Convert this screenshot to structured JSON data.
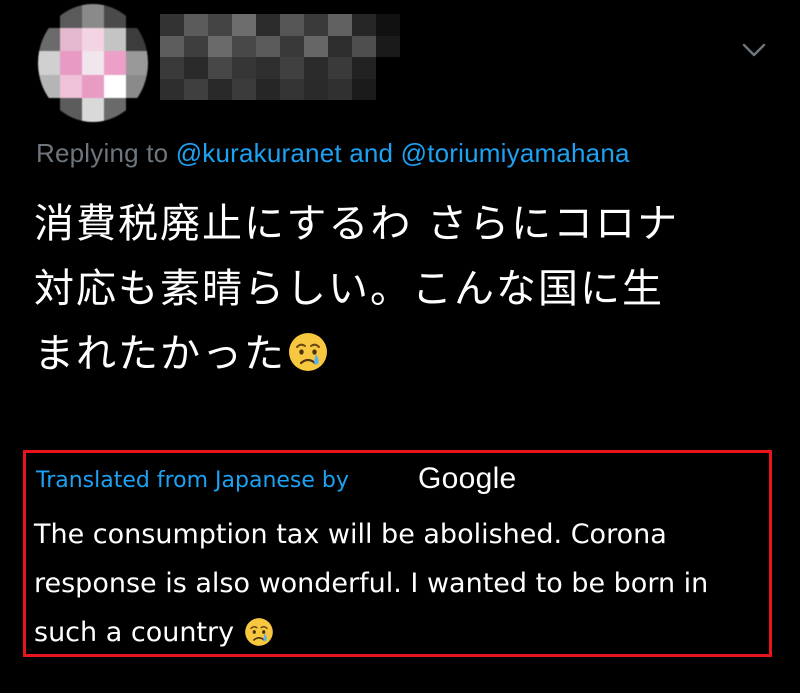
{
  "tweet": {
    "author_name": "",
    "author_handle": "",
    "reply": {
      "prefix": "Replying to ",
      "mention_1": "@kurakuranet",
      "conjunction": " and ",
      "mention_2": "@toriumiyamahana"
    },
    "text_lines": [
      "消費税廃止にするわ さらにコロナ",
      "対応も素晴らしい。こんな国に生",
      "まれたかった"
    ],
    "emoji": "crying-face"
  },
  "translation": {
    "label": "Translated from Japanese by",
    "provider": "Google",
    "text_lines": [
      "The consumption tax will be abolished. Corona",
      "response is also wonderful. I wanted to be born in",
      "such a country"
    ],
    "highlight_color": "#e8141b"
  },
  "colors": {
    "background": "#000000",
    "text": "#ffffff",
    "muted": "#6e767d",
    "link": "#1da1f2"
  },
  "icons": {
    "menu": "chevron-down-icon",
    "emoji": "crying-face-icon"
  }
}
